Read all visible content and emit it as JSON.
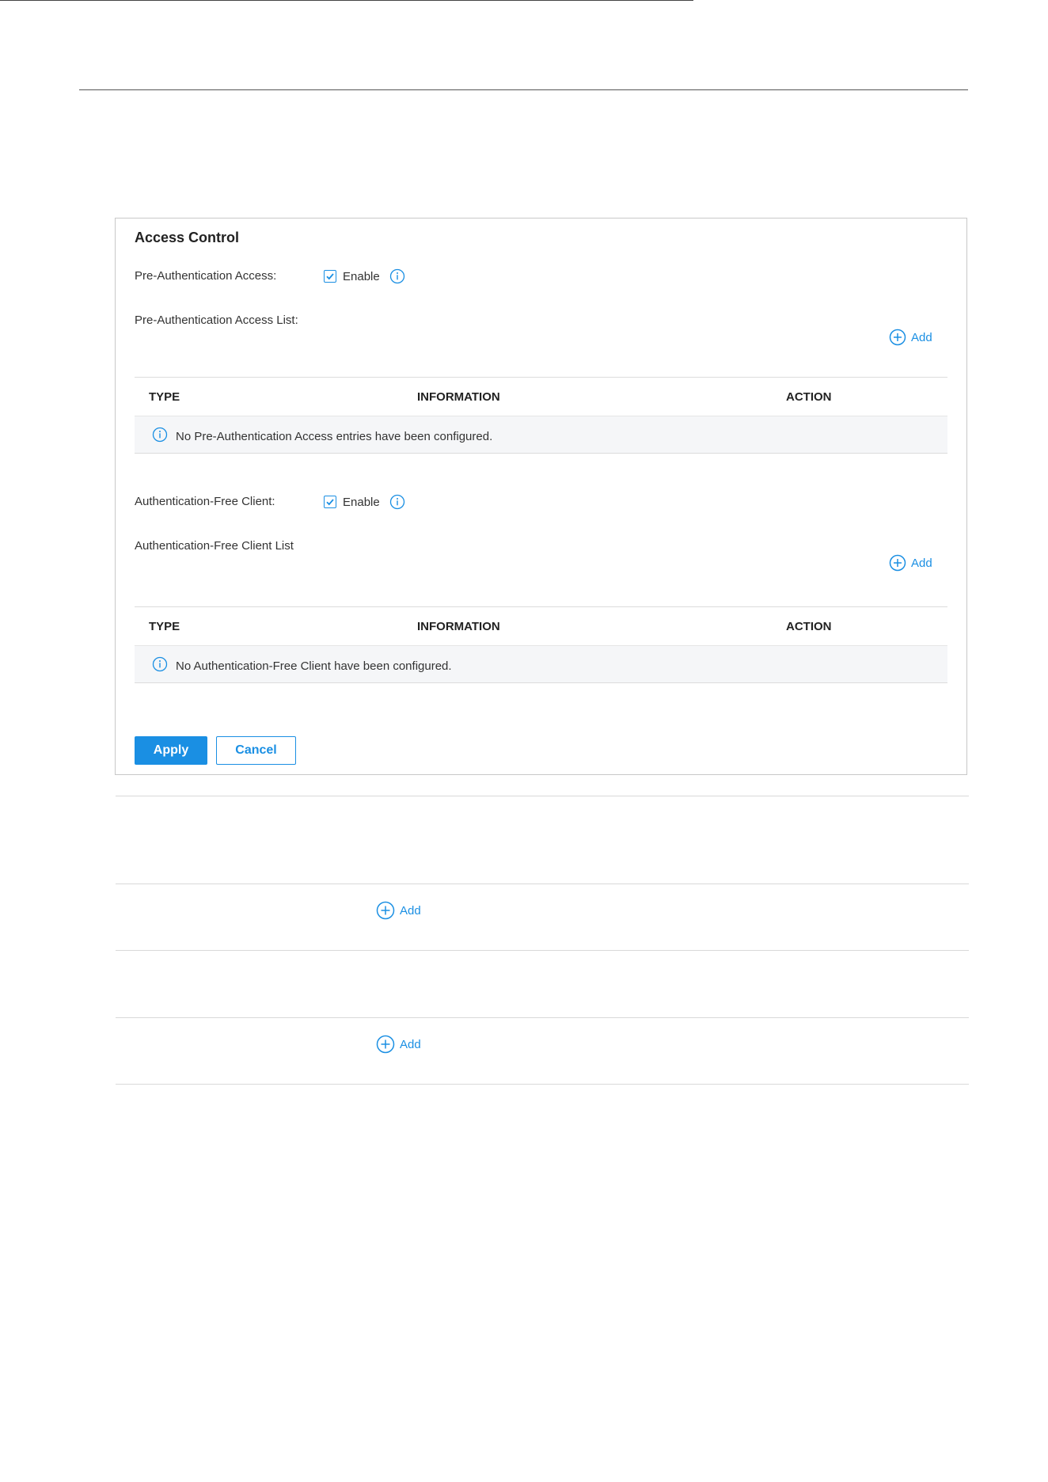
{
  "panel": {
    "title": "Access Control",
    "pre_auth": {
      "label": "Pre-Authentication Access:",
      "enable_label": "Enable",
      "enabled": true,
      "list_label": "Pre-Authentication Access List:",
      "add_label": "Add",
      "columns": [
        "TYPE",
        "INFORMATION",
        "ACTION"
      ],
      "empty_message": "No Pre-Authentication Access entries have been configured."
    },
    "auth_free": {
      "label": "Authentication-Free Client:",
      "enable_label": "Enable",
      "enabled": true,
      "list_label": "Authentication-Free Client List",
      "add_label": "Add",
      "columns": [
        "TYPE",
        "INFORMATION",
        "ACTION"
      ],
      "empty_message": "No Authentication-Free Client have been configured."
    },
    "apply_label": "Apply",
    "cancel_label": "Cancel"
  },
  "lower_rows": {
    "add_label_1": "Add",
    "add_label_2": "Add"
  },
  "colors": {
    "accent": "#1a8fe3",
    "table_body_bg": "#f5f6f8",
    "border": "#c8c8c8"
  },
  "icons": [
    "check-icon",
    "info-icon",
    "add-circle-icon"
  ]
}
